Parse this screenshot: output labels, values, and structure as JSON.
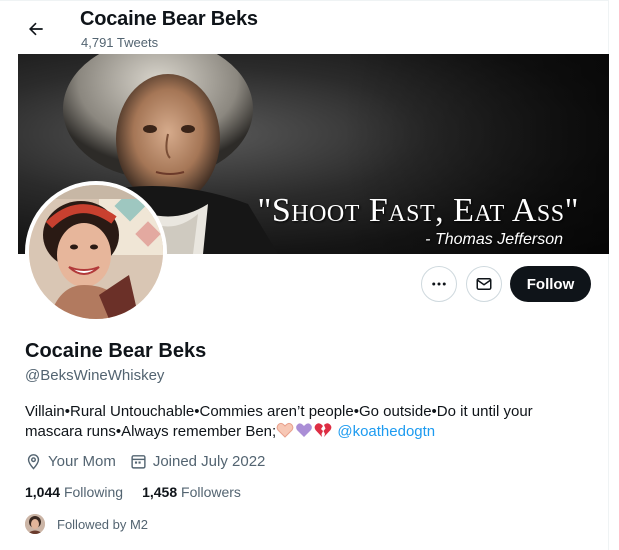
{
  "header": {
    "title": "Cocaine Bear Beks",
    "tweet_count": "4,791 Tweets",
    "back_icon": "arrow-left-icon"
  },
  "banner": {
    "quote": "\"Shoot Fast, Eat Ass\"",
    "attribution": "- Thomas Jefferson"
  },
  "actions": {
    "more_icon": "more-dots-icon",
    "message_icon": "envelope-icon",
    "follow_label": "Follow"
  },
  "profile": {
    "display_name": "Cocaine Bear Beks",
    "handle": "@BeksWineWhiskey",
    "bio_text": "Villain•Rural Untouchable•Commies aren’t people•Go outside•Do it until your mascara runs•Always remember Ben;",
    "bio_emojis": [
      "heart-hands-emoji",
      "purple-heart-emoji",
      "broken-heart-emoji"
    ],
    "bio_mention": "@koathedogtn",
    "location": "Your Mom",
    "joined": "Joined July 2022"
  },
  "stats": {
    "following_count": "1,044",
    "following_label": "Following",
    "followers_count": "1,458",
    "followers_label": "Followers"
  },
  "followed_by": "Followed by M2",
  "colors": {
    "accent": "#1d9bf0",
    "text_primary": "#0f1419",
    "text_secondary": "#536471",
    "button_dark": "#0f1419"
  }
}
